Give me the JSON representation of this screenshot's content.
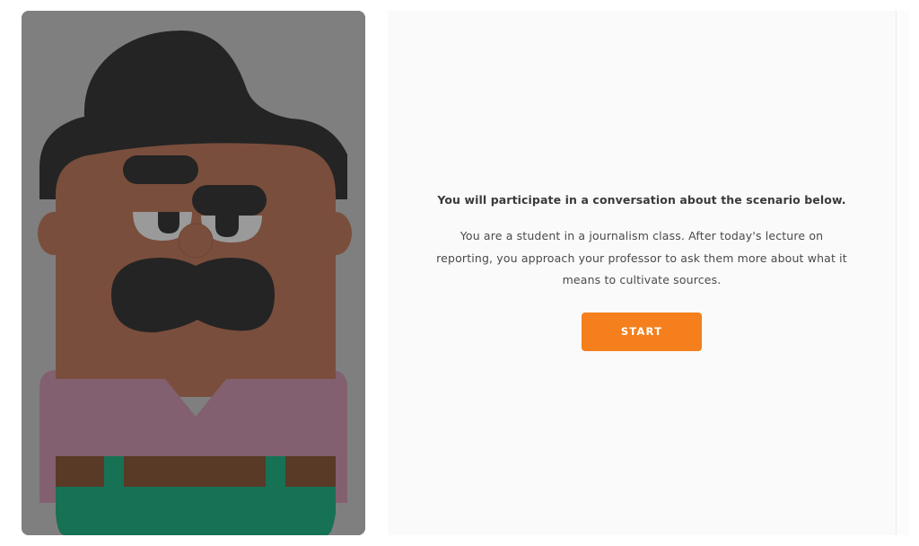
{
  "scenario": {
    "intro": "You will participate in a conversation about the scenario below.",
    "description": "You are a student in a journalism class. After today's lecture on reporting, you approach your professor to ask them more about what it means to cultivate sources.",
    "start_label": "START"
  },
  "character": {
    "illustration": "professor-character-illustration",
    "colors": {
      "background": "#7f7f7f",
      "hair": "#242424",
      "skin": "#7a4e3c",
      "eye_whites": "#9a9a9a",
      "shirt": "#82606f",
      "belt": "#583a27",
      "pants": "#177154"
    }
  },
  "colors": {
    "accent": "#f47f1c",
    "panel_background": "#fafafa"
  }
}
